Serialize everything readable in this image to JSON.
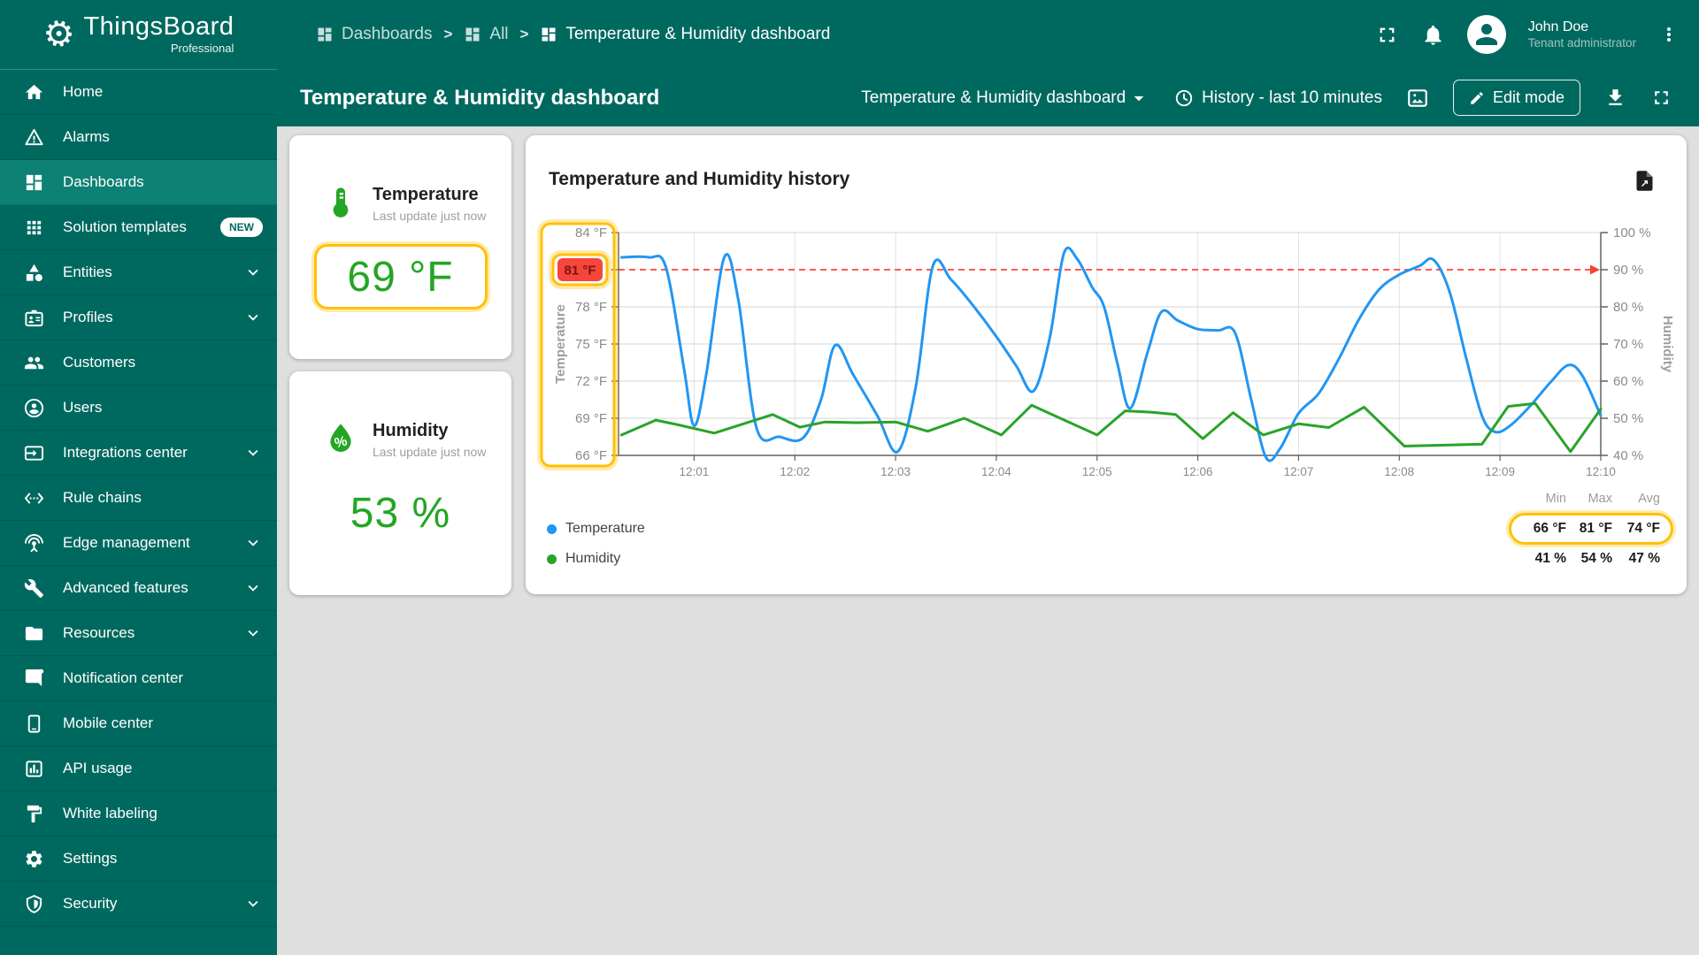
{
  "colors": {
    "primary": "#00695f",
    "primary_selected": "#0c8174",
    "accent_yellow": "#ffc107",
    "value_green": "#23a623",
    "series_temperature": "#2196f3",
    "series_humidity": "#2aa32a",
    "threshold_red": "#f44336",
    "content_background": "#dfdfdf"
  },
  "topbar": {
    "brand": {
      "name": "ThingsBoard",
      "edition": "Professional",
      "logo_icon": "thingsboard-logo-icon"
    },
    "breadcrumb": [
      {
        "label": "Dashboards",
        "icon": "dashboards-icon"
      },
      {
        "label": "All",
        "icon": "dashboards-icon"
      },
      {
        "label": "Temperature & Humidity dashboard",
        "icon": "dashboards-icon"
      }
    ],
    "breadcrumb_separator": ">",
    "user": {
      "name": "John Doe",
      "role": "Tenant administrator"
    }
  },
  "sidebar": {
    "items": [
      {
        "label": "Home",
        "icon": "home-icon"
      },
      {
        "label": "Alarms",
        "icon": "alarms-icon"
      },
      {
        "label": "Dashboards",
        "icon": "dashboards-icon",
        "selected": true
      },
      {
        "label": "Solution templates",
        "icon": "solution-templates-icon",
        "badge": "NEW"
      },
      {
        "label": "Entities",
        "icon": "entities-icon",
        "expandable": true
      },
      {
        "label": "Profiles",
        "icon": "profiles-icon",
        "expandable": true
      },
      {
        "label": "Customers",
        "icon": "customers-icon"
      },
      {
        "label": "Users",
        "icon": "users-icon"
      },
      {
        "label": "Integrations center",
        "icon": "integrations-icon",
        "expandable": true
      },
      {
        "label": "Rule chains",
        "icon": "rule-chains-icon"
      },
      {
        "label": "Edge management",
        "icon": "edge-management-icon",
        "expandable": true
      },
      {
        "label": "Advanced features",
        "icon": "advanced-features-icon",
        "expandable": true
      },
      {
        "label": "Resources",
        "icon": "resources-icon",
        "expandable": true
      },
      {
        "label": "Notification center",
        "icon": "notification-center-icon"
      },
      {
        "label": "Mobile center",
        "icon": "mobile-center-icon"
      },
      {
        "label": "API usage",
        "icon": "api-usage-icon"
      },
      {
        "label": "White labeling",
        "icon": "white-labeling-icon"
      },
      {
        "label": "Settings",
        "icon": "settings-icon"
      },
      {
        "label": "Security",
        "icon": "security-icon",
        "expandable": true
      }
    ]
  },
  "toolbar": {
    "title": "Temperature & Humidity dashboard",
    "state_selector": {
      "label": "Temperature & Humidity dashboard"
    },
    "time_window": {
      "label": "History - last 10 minutes"
    },
    "edit_button": {
      "label": "Edit mode"
    }
  },
  "widgets": {
    "temperature_card": {
      "icon": "thermometer-icon",
      "title": "Temperature",
      "subtitle": "Last update just now",
      "value": "69 °F"
    },
    "humidity_card": {
      "icon": "humidity-drop-icon",
      "title": "Humidity",
      "subtitle": "Last update just now",
      "value": "53 %"
    },
    "history_chart": {
      "title": "Temperature and Humidity history",
      "legend": [
        {
          "label": "Temperature",
          "color": "#2196f3"
        },
        {
          "label": "Humidity",
          "color": "#2aa32a"
        }
      ],
      "stats": {
        "headers": [
          "Min",
          "Max",
          "Avg"
        ],
        "rows": [
          {
            "series": "Temperature",
            "values": [
              "66 °F",
              "81 °F",
              "74 °F"
            ],
            "highlighted": true
          },
          {
            "series": "Humidity",
            "values": [
              "41 %",
              "54 %",
              "47 %"
            ],
            "highlighted": false
          }
        ]
      },
      "chart_data": {
        "type": "line",
        "x_ticks": [
          "12:01",
          "12:02",
          "12:03",
          "12:04",
          "12:05",
          "12:06",
          "12:07",
          "12:08",
          "12:09",
          "12:10"
        ],
        "x_range_minutes": [
          0.25,
          10
        ],
        "grid": true,
        "legend_position": "bottom-left",
        "left_axis": {
          "label": "Temperature",
          "range": [
            66,
            84
          ],
          "ticks": [
            {
              "v": 84,
              "label": "84 °F"
            },
            {
              "v": 78,
              "label": "78 °F"
            },
            {
              "v": 75,
              "label": "75 °F"
            },
            {
              "v": 72,
              "label": "72 °F"
            },
            {
              "v": 69,
              "label": "69 °F"
            },
            {
              "v": 66,
              "label": "66 °F"
            }
          ],
          "threshold": {
            "v": 81,
            "label": "81 °F"
          },
          "highlighted": true
        },
        "right_axis": {
          "label": "Humidity",
          "range": [
            40,
            100
          ],
          "ticks": [
            {
              "v": 100,
              "label": "100 %"
            },
            {
              "v": 90,
              "label": "90 %"
            },
            {
              "v": 80,
              "label": "80 %"
            },
            {
              "v": 70,
              "label": "70 %"
            },
            {
              "v": 60,
              "label": "60 %"
            },
            {
              "v": 50,
              "label": "50 %"
            },
            {
              "v": 40,
              "label": "40 %"
            }
          ]
        },
        "series": [
          {
            "name": "Temperature",
            "axis": "left",
            "color": "#2196f3",
            "smooth": true,
            "points": [
              [
                0.28,
                82
              ],
              [
                0.55,
                82
              ],
              [
                0.72,
                81.2
              ],
              [
                0.9,
                73
              ],
              [
                1.0,
                68.4
              ],
              [
                1.12,
                72.5
              ],
              [
                1.3,
                82
              ],
              [
                1.44,
                78.5
              ],
              [
                1.62,
                68.2
              ],
              [
                1.85,
                67.5
              ],
              [
                2.08,
                67.4
              ],
              [
                2.26,
                70.5
              ],
              [
                2.4,
                74.9
              ],
              [
                2.58,
                72.5
              ],
              [
                2.82,
                69.2
              ],
              [
                3.02,
                66.3
              ],
              [
                3.2,
                71.5
              ],
              [
                3.37,
                81.3
              ],
              [
                3.55,
                80.2
              ],
              [
                3.76,
                78.2
              ],
              [
                4.0,
                75.6
              ],
              [
                4.2,
                73.2
              ],
              [
                4.37,
                71.2
              ],
              [
                4.53,
                75.5
              ],
              [
                4.67,
                82.3
              ],
              [
                4.8,
                81.9
              ],
              [
                4.95,
                79.6
              ],
              [
                5.07,
                78
              ],
              [
                5.2,
                73.5
              ],
              [
                5.33,
                69.8
              ],
              [
                5.5,
                74.3
              ],
              [
                5.64,
                77.6
              ],
              [
                5.8,
                76.9
              ],
              [
                6.0,
                76.2
              ],
              [
                6.2,
                76.1
              ],
              [
                6.37,
                75.9
              ],
              [
                6.53,
                70.5
              ],
              [
                6.68,
                65.8
              ],
              [
                6.82,
                66.6
              ],
              [
                7.0,
                69.4
              ],
              [
                7.2,
                71
              ],
              [
                7.4,
                73.8
              ],
              [
                7.6,
                77
              ],
              [
                7.8,
                79.4
              ],
              [
                8.0,
                80.6
              ],
              [
                8.2,
                81.3
              ],
              [
                8.34,
                81.8
              ],
              [
                8.5,
                79.2
              ],
              [
                8.66,
                74
              ],
              [
                8.82,
                69.2
              ],
              [
                8.95,
                67.9
              ],
              [
                9.1,
                68.4
              ],
              [
                9.3,
                70
              ],
              [
                9.5,
                71.9
              ],
              [
                9.68,
                73.3
              ],
              [
                9.82,
                72.4
              ],
              [
                10,
                69.2
              ]
            ]
          },
          {
            "name": "Humidity",
            "axis": "right",
            "color": "#2aa32a",
            "smooth": false,
            "points": [
              [
                0.28,
                45.5
              ],
              [
                0.62,
                49.5
              ],
              [
                0.85,
                48.2
              ],
              [
                1.2,
                46
              ],
              [
                1.5,
                48.6
              ],
              [
                1.78,
                51
              ],
              [
                2.05,
                47.6
              ],
              [
                2.3,
                49
              ],
              [
                2.62,
                48.8
              ],
              [
                3.0,
                49
              ],
              [
                3.32,
                46.5
              ],
              [
                3.68,
                50
              ],
              [
                4.05,
                45.5
              ],
              [
                4.35,
                53.5
              ],
              [
                4.7,
                49.2
              ],
              [
                5.0,
                45.5
              ],
              [
                5.28,
                52
              ],
              [
                5.55,
                51.6
              ],
              [
                5.78,
                51
              ],
              [
                6.05,
                44.5
              ],
              [
                6.35,
                51.5
              ],
              [
                6.65,
                45.5
              ],
              [
                7.0,
                48.5
              ],
              [
                7.3,
                47.5
              ],
              [
                7.65,
                53
              ],
              [
                8.05,
                42.5
              ],
              [
                8.5,
                42.8
              ],
              [
                8.82,
                43
              ],
              [
                9.08,
                53.2
              ],
              [
                9.35,
                54
              ],
              [
                9.7,
                41
              ],
              [
                10,
                52.5
              ]
            ]
          }
        ]
      }
    }
  }
}
